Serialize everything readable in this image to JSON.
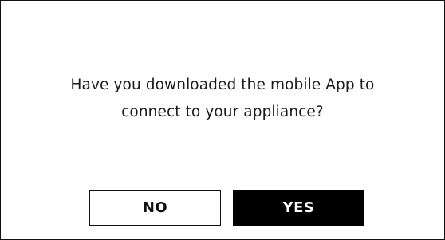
{
  "dialog": {
    "message_line1": "Have you downloaded the mobile App to",
    "message_line2": "connect to your appliance?",
    "no_label": "NO",
    "yes_label": "YES"
  },
  "colors": {
    "background": "#ffffff",
    "border": "#111111",
    "primary_button_bg": "#000000",
    "primary_button_text": "#ffffff",
    "secondary_button_bg": "#ffffff",
    "secondary_button_text": "#111111"
  }
}
